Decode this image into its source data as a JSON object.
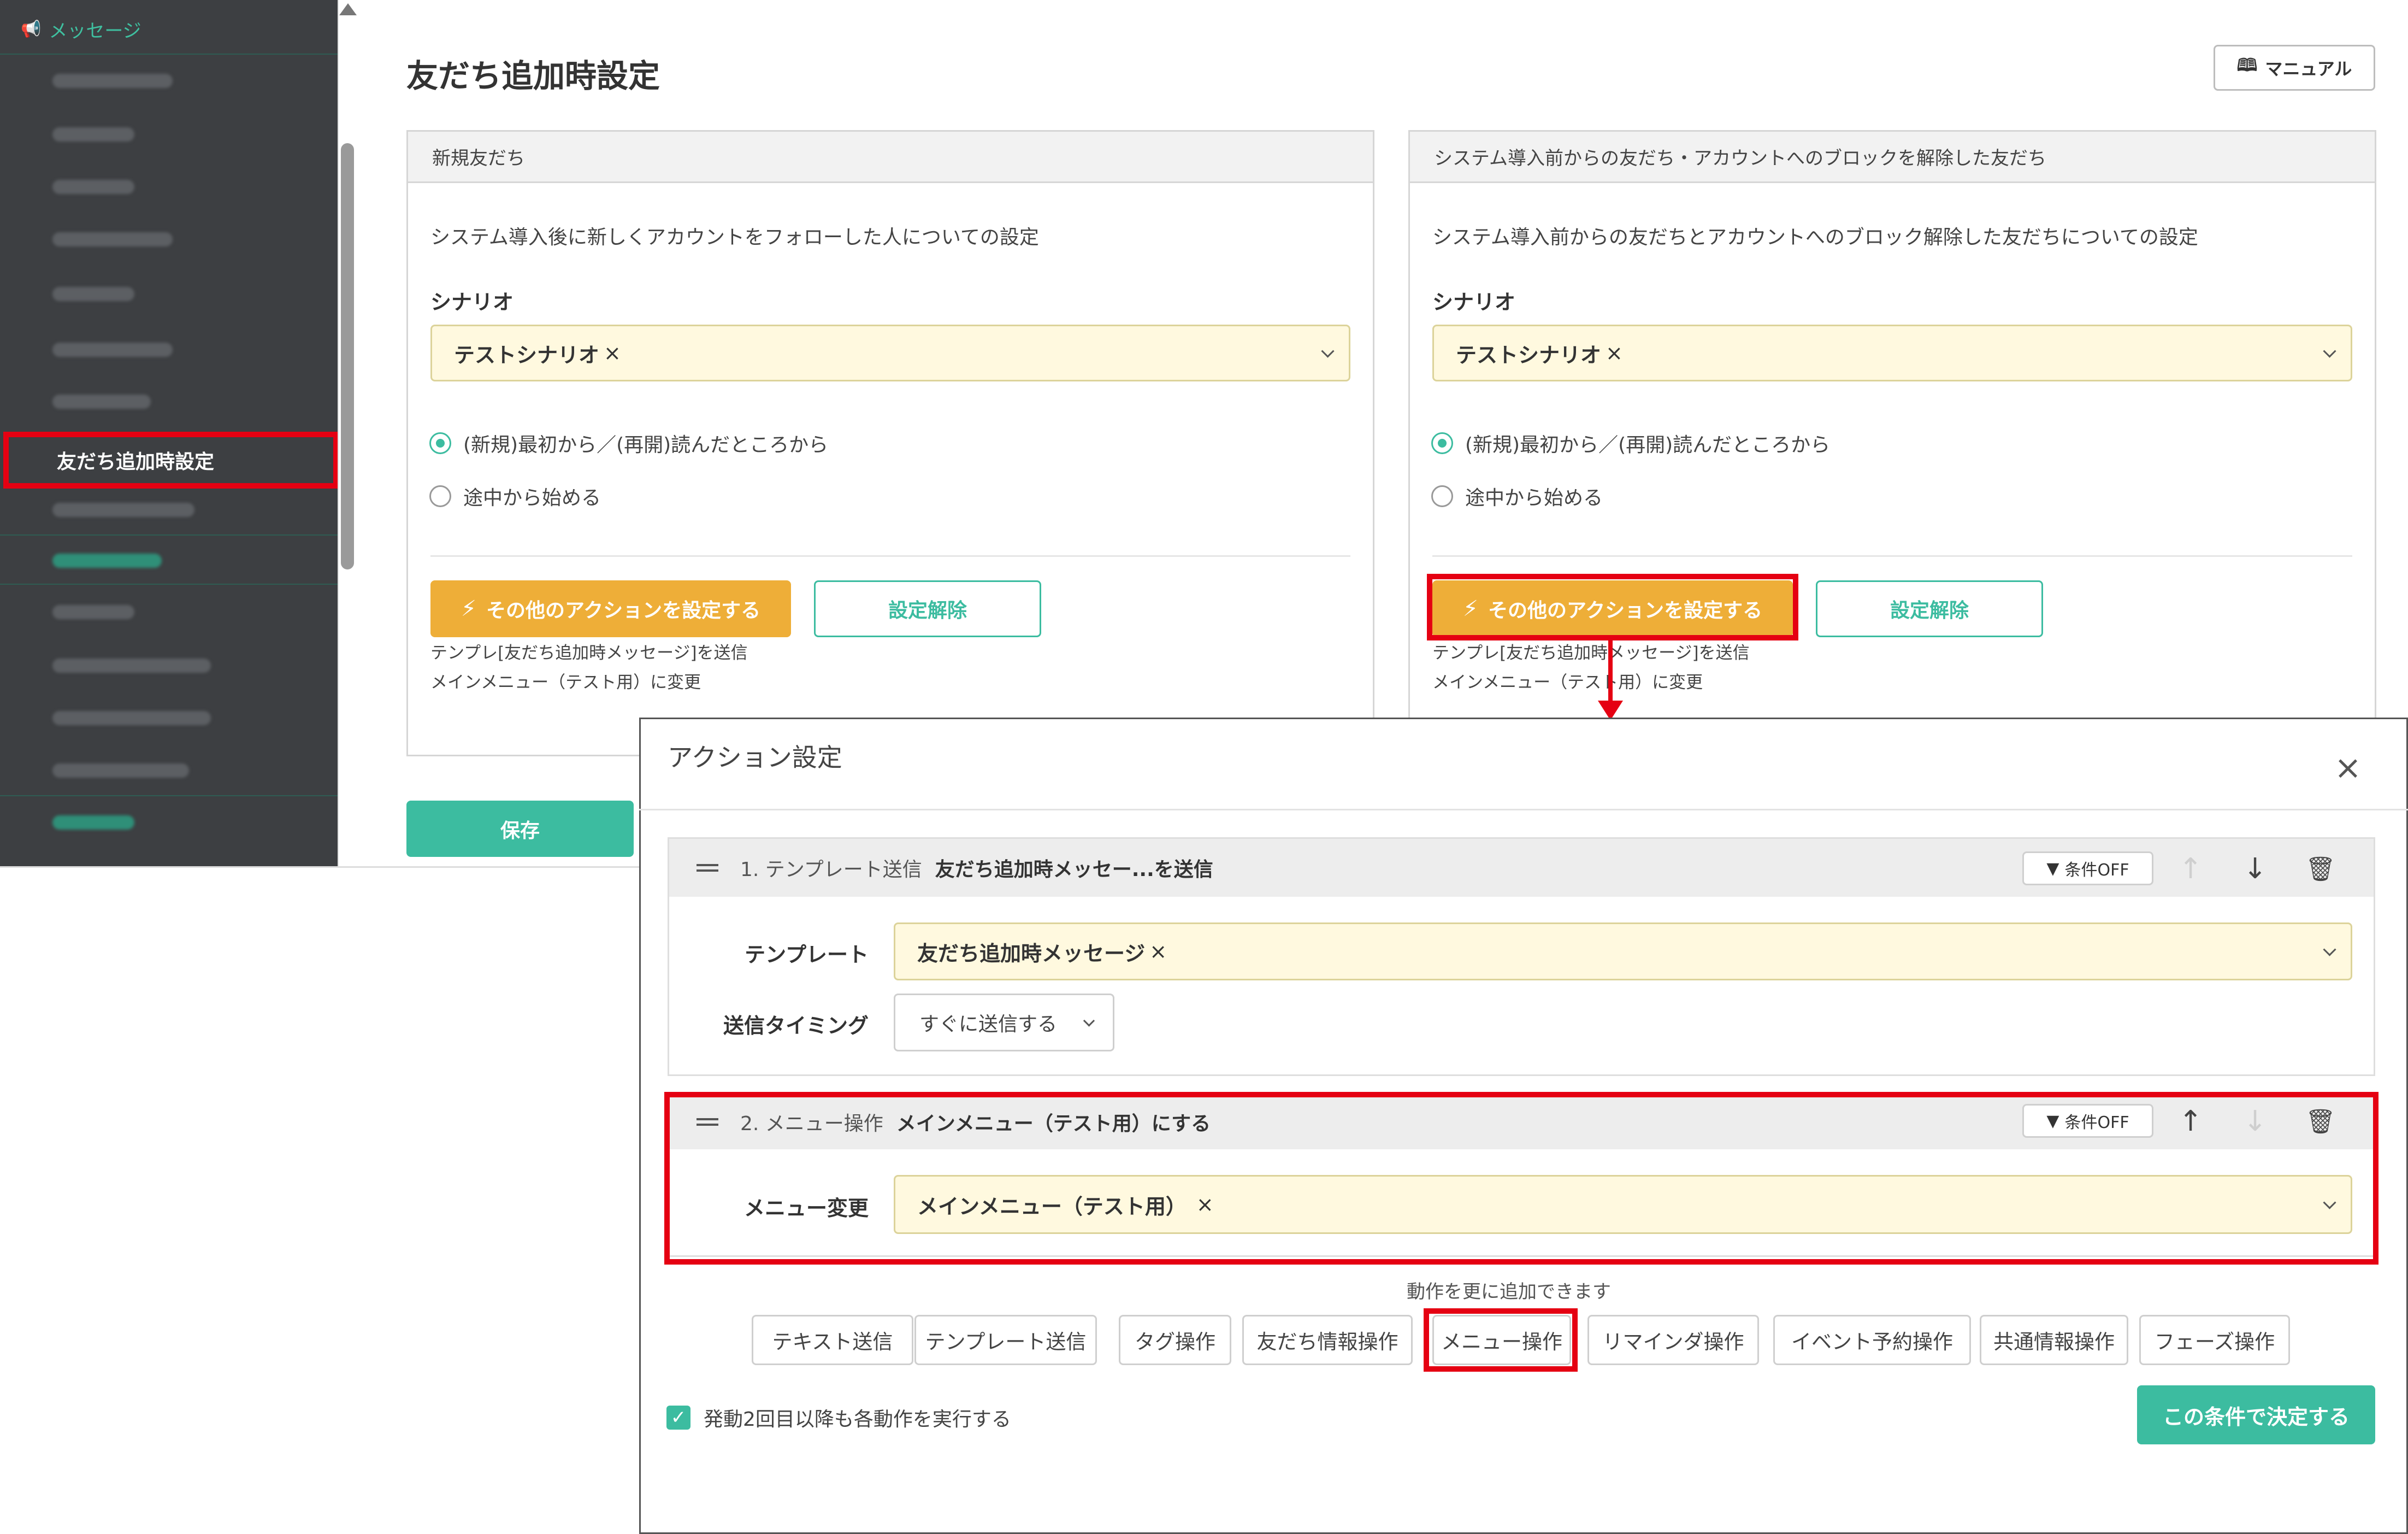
{
  "sidebar": {
    "section_label": "メッセージ",
    "active_item": "友だち追加時設定"
  },
  "page": {
    "title": "友だち追加時設定",
    "manual_button": "マニュアル",
    "save_button": "保存"
  },
  "cards": [
    {
      "header": "新規友だち",
      "description": "システム導入後に新しくアカウントをフォローした人についての設定",
      "scenario_label": "シナリオ",
      "scenario_value": "テストシナリオ",
      "radio_1": "(新規)最初から／(再開)読んだところから",
      "radio_2": "途中から始める",
      "action_button": "その他のアクションを設定する",
      "clear_button": "設定解除",
      "note_1": "テンプレ[友だち追加時メッセージ]を送信",
      "note_2": "メインメニュー（テスト用）に変更"
    },
    {
      "header": "システム導入前からの友だち・アカウントへのブロックを解除した友だち",
      "description": "システム導入前からの友だちとアカウントへのブロック解除した友だちについての設定",
      "scenario_label": "シナリオ",
      "scenario_value": "テストシナリオ",
      "radio_1": "(新規)最初から／(再開)読んだところから",
      "radio_2": "途中から始める",
      "action_button": "その他のアクションを設定する",
      "clear_button": "設定解除",
      "note_1": "テンプレ[友だち追加時メッセージ]を送信",
      "note_2": "メインメニュー（テスト用）に変更"
    }
  ],
  "modal": {
    "title": "アクション設定",
    "close": "×",
    "actions": [
      {
        "number_type": "1. テンプレート送信",
        "summary": "友だち追加時メッセー...を送信",
        "condition": "条件OFF",
        "rows": [
          {
            "label": "テンプレート",
            "value": "友だち追加時メッセージ"
          },
          {
            "label": "送信タイミング",
            "value": "すぐに送信する"
          }
        ]
      },
      {
        "number_type": "2. メニュー操作",
        "summary": "メインメニュー（テスト用）にする",
        "condition": "条件OFF",
        "rows": [
          {
            "label": "メニュー変更",
            "value": "メインメニュー（テスト用）"
          }
        ]
      }
    ],
    "add_hint": "動作を更に追加できます",
    "chips": [
      "テキスト送信",
      "テンプレート送信",
      "タグ操作",
      "友だち情報操作",
      "メニュー操作",
      "リマインダ操作",
      "イベント予約操作",
      "共通情報操作",
      "フェーズ操作"
    ],
    "checkbox_label": "発動2回目以降も各動作を実行する",
    "decide_button": "この条件で決定する"
  },
  "colors": {
    "accent_green": "#3cbca0",
    "action_orange": "#eeae38",
    "highlight_red": "#e50012",
    "sidebar_bg": "#3d3f42",
    "select_bg": "#fff9df"
  },
  "icons": {
    "sidebar_section": "megaphone-icon",
    "manual": "book-icon",
    "action": "lightning-icon",
    "condition": "filter-icon"
  }
}
